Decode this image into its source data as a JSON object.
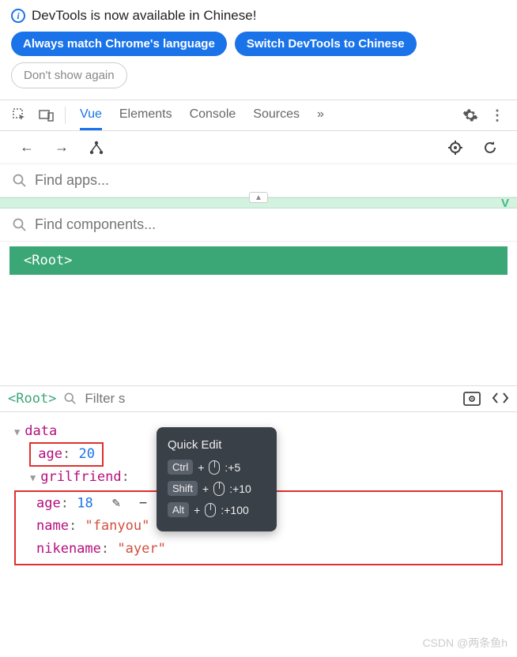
{
  "banner": {
    "message": "DevTools is now available in Chinese!",
    "always_match": "Always match Chrome's language",
    "switch_to": "Switch DevTools to Chinese",
    "dont_show": "Don't show again"
  },
  "tabs": {
    "vue": "Vue",
    "elements": "Elements",
    "console": "Console",
    "sources": "Sources"
  },
  "search": {
    "apps_placeholder": "Find apps...",
    "components_placeholder": "Find components..."
  },
  "root_label": "<Root>",
  "breadcrumb_root": "<Root>",
  "filter_placeholder": "Filter s",
  "tooltip": {
    "title": "Quick Edit",
    "k1": "Ctrl",
    "s1": ":+5",
    "k2": "Shift",
    "s2": ":+10",
    "k3": "Alt",
    "s3": ":+100"
  },
  "tree": {
    "data_key": "data",
    "age1_key": "age",
    "age1_val": "20",
    "gf_key": "grilfriend",
    "age2_key": "age",
    "age2_val": "18",
    "name_key": "name",
    "name_val": "\"fanyou\"",
    "nike_key": "nikename",
    "nike_val": "\"ayer\""
  },
  "colors": {
    "blue": "#1a73e8",
    "green": "#3ba776",
    "magenta": "#b40f7e",
    "orange": "#d14f3e",
    "red": "#e03030"
  },
  "watermark": "CSDN @两条鱼h"
}
